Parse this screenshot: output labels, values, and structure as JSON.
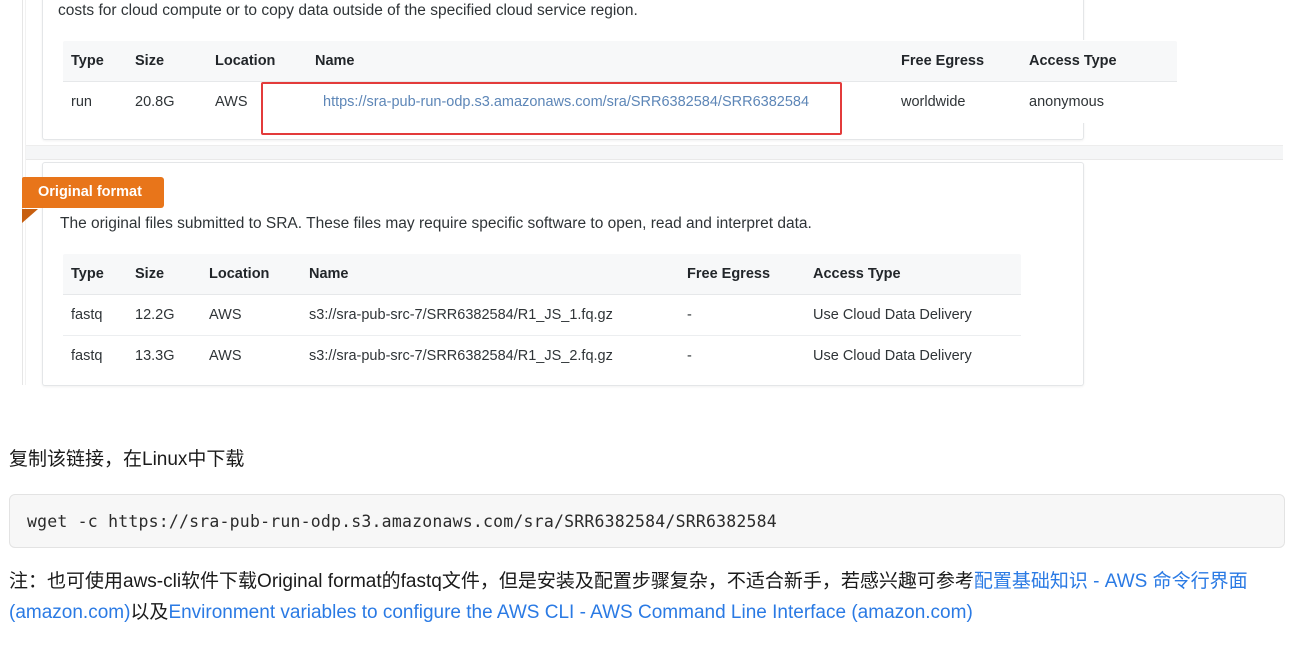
{
  "intro_text": "costs for cloud compute or to copy data outside of the specified cloud service region.",
  "run_table": {
    "headers": [
      "Type",
      "Size",
      "Location",
      "Name",
      "Free Egress",
      "Access Type"
    ],
    "rows": [
      {
        "type": "run",
        "size": "20.8G",
        "location": "AWS",
        "name": "https://sra-pub-run-odp.s3.amazonaws.com/sra/SRR6382584/SRR6382584",
        "free_egress": "worldwide",
        "access_type": "anonymous"
      }
    ]
  },
  "original_format": {
    "ribbon_label": "Original format",
    "description": "The original files submitted to SRA. These files may require specific software to open, read and interpret data.",
    "headers": [
      "Type",
      "Size",
      "Location",
      "Name",
      "Free Egress",
      "Access Type"
    ],
    "rows": [
      {
        "type": "fastq",
        "size": "12.2G",
        "location": "AWS",
        "name": "s3://sra-pub-src-7/SRR6382584/R1_JS_1.fq.gz",
        "free_egress": "-",
        "access_type": "Use Cloud Data Delivery"
      },
      {
        "type": "fastq",
        "size": "13.3G",
        "location": "AWS",
        "name": "s3://sra-pub-src-7/SRR6382584/R1_JS_2.fq.gz",
        "free_egress": "-",
        "access_type": "Use Cloud Data Delivery"
      }
    ]
  },
  "caption": "复制该链接，在Linux中下载",
  "code": "wget -c https://sra-pub-run-odp.s3.amazonaws.com/sra/SRR6382584/SRR6382584",
  "footnote": {
    "part1": "注：也可使用aws-cli软件下载Original format的fastq文件，但是安装及配置步骤复杂，不适合新手，若感兴趣可参考",
    "link1": "配置基础知识 - AWS 命令行界面 (amazon.com)",
    "middle": "以及",
    "link2": "Environment variables to configure the AWS CLI - AWS Command Line Interface (amazon.com)"
  },
  "colors": {
    "ribbon_orange": "#e8751a",
    "ribbon_orange_dark": "#c75f10",
    "highlight_red": "#e33b3b",
    "table_link_blue": "#5d86b7",
    "footnote_link_blue": "#2a7ae4",
    "code_bg": "#f7f7f7",
    "table_header_bg": "#f7f8f9"
  }
}
